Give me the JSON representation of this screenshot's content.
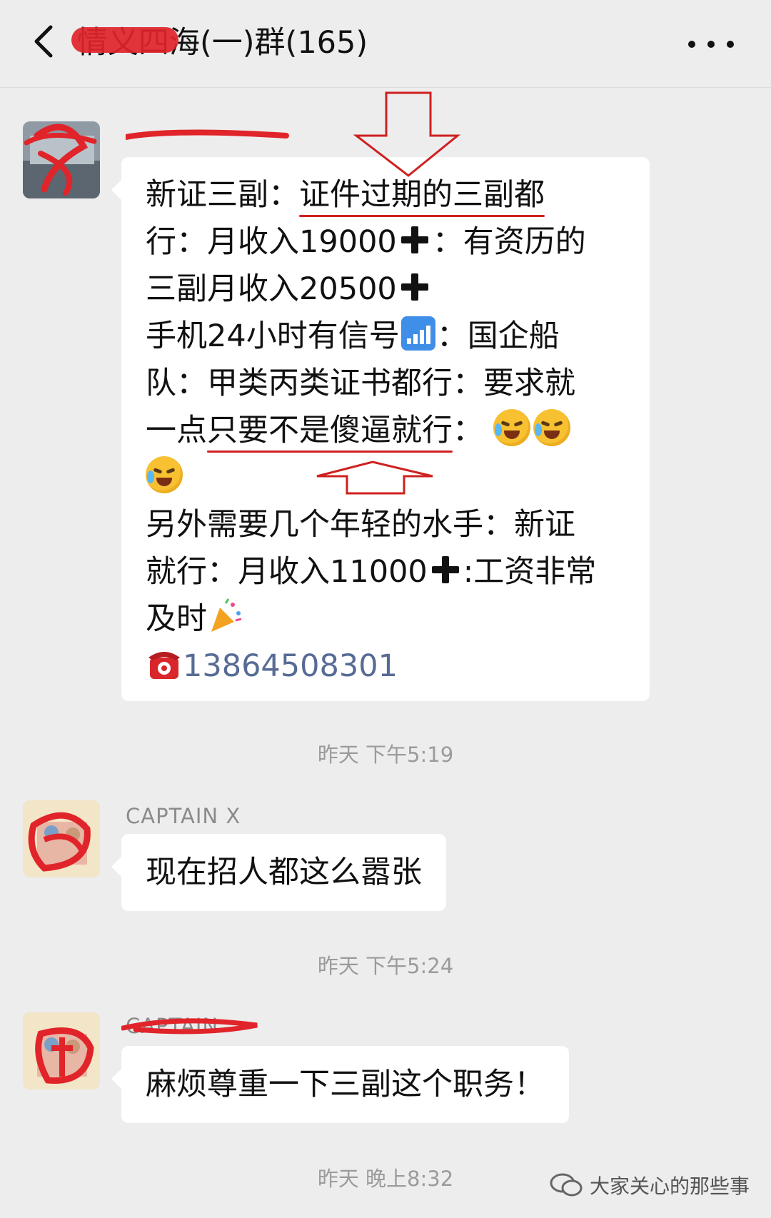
{
  "header": {
    "title": "情义四海(一)群(165)",
    "back_icon": "chevron-left-icon",
    "more_icon": "more-dots-icon"
  },
  "messages": [
    {
      "sender_name": "",
      "lines": [
        {
          "pre": "新证三副：",
          "ul": "证件过期的三副都",
          "post": ""
        },
        {
          "pre": "行：月收入19000",
          "post": "：有资历的"
        },
        {
          "pre": "三副月收入20500"
        },
        {
          "pre": "手机24小时有信号",
          "post": "：国企船"
        },
        {
          "pre": "队：甲类丙类证书都行：要求就"
        },
        {
          "pre": "一点",
          "ul": "只要不是傻逼就行",
          "post": "："
        },
        {
          "pre": ""
        },
        {
          "pre": "另外需要几个年轻的水手：新证"
        },
        {
          "pre": "就行：月收入11000",
          "post": ":工资非常"
        },
        {
          "pre": "及时"
        },
        {
          "phone": "13864508301"
        }
      ]
    },
    {
      "sender_name": "CAPTAIN X",
      "text": "现在招人都这么嚣张"
    },
    {
      "sender_name": "CAPTAIN",
      "text": "麻烦尊重一下三副这个职务！"
    }
  ],
  "timestamps": [
    "昨天 下午5:19",
    "昨天 下午5:24",
    "昨天 晚上8:32"
  ],
  "watermark": {
    "text": "大家关心的那些事",
    "icon": "wechat-channel-icon"
  }
}
